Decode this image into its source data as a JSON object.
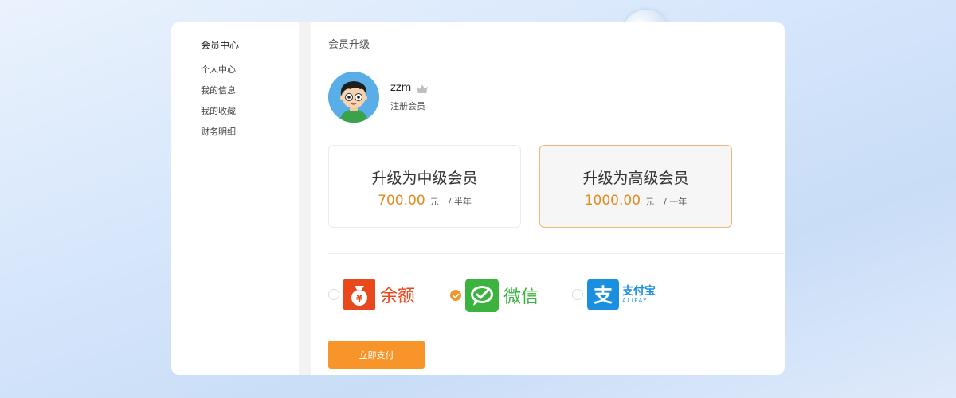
{
  "sidebar": {
    "title": "会员中心",
    "items": [
      {
        "label": "个人中心"
      },
      {
        "label": "我的信息"
      },
      {
        "label": "我的收藏"
      },
      {
        "label": "财务明细"
      }
    ]
  },
  "main": {
    "title": "会员升级",
    "user": {
      "name": "zzm",
      "level": "注册会员"
    },
    "plans": [
      {
        "name": "升级为中级会员",
        "price": "700.00",
        "unit": "元",
        "period": "/ 半年",
        "selected": false
      },
      {
        "name": "升级为高级会员",
        "price": "1000.00",
        "unit": "元",
        "period": "/ 一年",
        "selected": true
      }
    ],
    "payment": {
      "options": [
        {
          "id": "balance",
          "label": "余额",
          "checked": false,
          "color": "#e8481c"
        },
        {
          "id": "wechat",
          "label": "微信",
          "checked": true,
          "color": "#3bb33e"
        },
        {
          "id": "alipay",
          "label": "支付宝",
          "sublabel": "ALIPAY",
          "checked": false,
          "color": "#1a8fe0"
        }
      ],
      "submit_label": "立即支付"
    }
  },
  "colors": {
    "accent": "#f7952a",
    "price": "#e08b1e",
    "selected_border": "#e8b979"
  }
}
